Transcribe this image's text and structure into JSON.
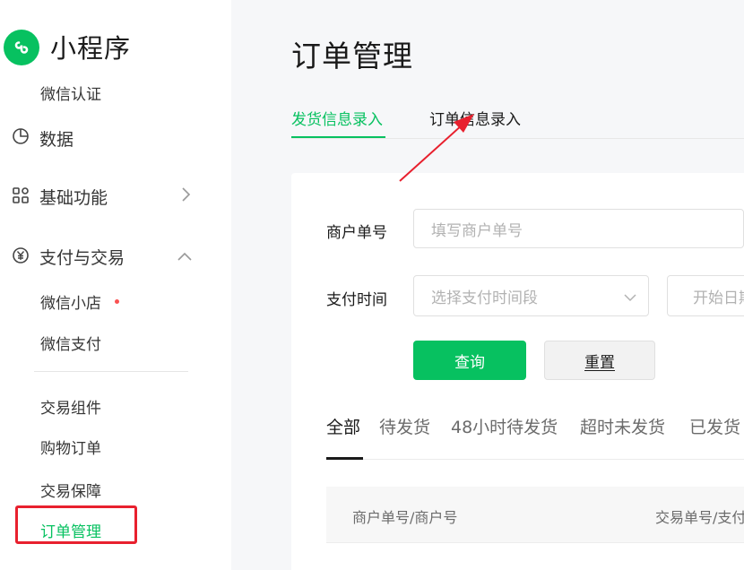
{
  "app": {
    "title": "小程序",
    "logo_icon": "miniprogram-logo-icon",
    "brand_color": "#07c160"
  },
  "sidebar": {
    "items": [
      {
        "label": "微信认证"
      },
      {
        "label": "数据",
        "icon": "pie-chart-icon"
      },
      {
        "label": "基础功能",
        "icon": "grid-icon",
        "expanded": false
      },
      {
        "label": "支付与交易",
        "icon": "yuan-icon",
        "expanded": true
      },
      {
        "label": "微信小店",
        "badge": "red-dot"
      },
      {
        "label": "微信支付"
      },
      {
        "label": "交易组件"
      },
      {
        "label": "购物订单"
      },
      {
        "label": "交易保障"
      },
      {
        "label": "订单管理",
        "active": true
      }
    ]
  },
  "main": {
    "title": "订单管理",
    "tabs": [
      {
        "label": "发货信息录入",
        "active": true
      },
      {
        "label": "订单信息录入"
      }
    ],
    "form": {
      "merchant_label": "商户单号",
      "merchant_placeholder": "填写商户单号",
      "pay_time_label": "支付时间",
      "pay_time_select": "选择支付时间段",
      "start_date_placeholder": "开始日期",
      "query_button": "查询",
      "reset_button": "重置"
    },
    "filters": [
      {
        "label": "全部",
        "active": true
      },
      {
        "label": "待发货"
      },
      {
        "label": "48小时待发货"
      },
      {
        "label": "超时未发货"
      },
      {
        "label": "已发货"
      }
    ],
    "table": {
      "columns": [
        "商户单号/商户号",
        "交易单号/支付"
      ]
    }
  },
  "annotation": {
    "color": "#e8202e"
  }
}
